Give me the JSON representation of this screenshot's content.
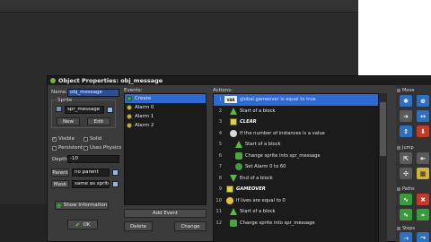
{
  "window": {
    "title": "Object Properties: obj_message"
  },
  "properties": {
    "name_label": "Name:",
    "name_value": "obj_message",
    "sprite_label": "Sprite",
    "sprite_value": "spr_message",
    "new_label": "New",
    "edit_label": "Edit",
    "visible_label": "Visible",
    "solid_label": "Solid",
    "persistent_label": "Persistent",
    "physics_label": "Uses Physics",
    "depth_label": "Depth:",
    "depth_value": "-10",
    "parent_label": "Parent",
    "parent_value": "no parent",
    "mask_label": "Mask",
    "mask_value": "same as sprite",
    "show_info_label": "Show Information",
    "ok_label": "OK",
    "visible_checked": "✓"
  },
  "events": {
    "header": "Events:",
    "items": [
      {
        "label": "Create",
        "icon": "create-bulb-icon"
      },
      {
        "label": "Alarm 0",
        "icon": "alarm-clock-icon"
      },
      {
        "label": "Alarm 1",
        "icon": "alarm-clock-icon"
      },
      {
        "label": "Alarm 2",
        "icon": "alarm-clock-icon"
      }
    ],
    "add_label": "Add Event",
    "delete_label": "Delete",
    "change_label": "Change"
  },
  "actions": {
    "header": "Actions:",
    "items": [
      {
        "num": "1",
        "text": "global.gameover is equal to true",
        "icon": "var"
      },
      {
        "num": "2",
        "text": "Start of a block",
        "icon": "tri"
      },
      {
        "num": "3",
        "text": "CLEAR",
        "icon": "cmt"
      },
      {
        "num": "4",
        "text": "If the number of instances is a value",
        "icon": "qcircle"
      },
      {
        "num": "5",
        "text": "Start of a block",
        "icon": "tri"
      },
      {
        "num": "6",
        "text": "Change sprite into spr_message",
        "icon": "spr"
      },
      {
        "num": "7",
        "text": "Set Alarm 0 to 60",
        "icon": "alarm"
      },
      {
        "num": "8",
        "text": "End of a block",
        "icon": "tri"
      },
      {
        "num": "9",
        "text": "GAMEOVER",
        "icon": "cmt"
      },
      {
        "num": "10",
        "text": "If lives are equal to 0",
        "icon": "qcircle"
      },
      {
        "num": "11",
        "text": "Start of a block",
        "icon": "tri"
      },
      {
        "num": "12",
        "text": "Change sprite into spr_message",
        "icon": "spr"
      }
    ],
    "var_icon_text": "VAR"
  },
  "palette": {
    "move_tab": "Move",
    "jump_tab": "Jump",
    "paths_tab": "Paths",
    "steps_tab": "Steps"
  }
}
